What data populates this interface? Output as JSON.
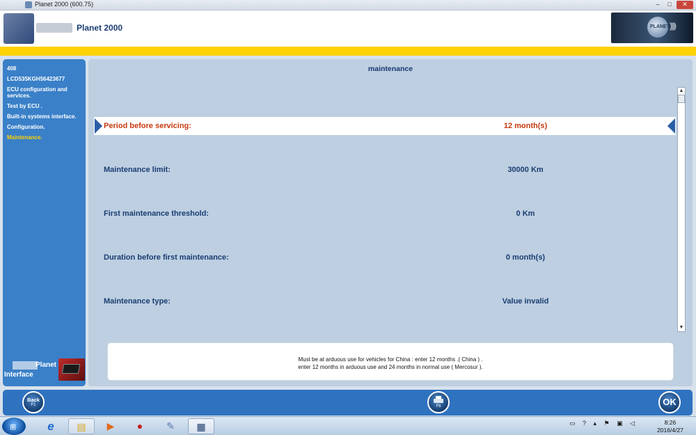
{
  "window": {
    "title": "Planet 2000 (600.75)",
    "min_label": "–",
    "max_label": "□",
    "close_label": "✕"
  },
  "header": {
    "app_title": "Planet 2000",
    "brand_text": "PLANET",
    "brand_waves": "))))"
  },
  "sidebar": {
    "items": [
      {
        "label": "408",
        "active": false
      },
      {
        "label": "LCD535KGH56423677",
        "active": false
      },
      {
        "label": "ECU configuration and services.",
        "active": false
      },
      {
        "label": "Test by ECU .",
        "active": false
      },
      {
        "label": "Built-in systems interface.",
        "active": false
      },
      {
        "label": "Configuration.",
        "active": false
      },
      {
        "label": "Maintenance.",
        "active": true
      }
    ],
    "logo_planet": "Planet",
    "logo_interface": "Interface"
  },
  "main": {
    "title": "maintenance",
    "rows": [
      {
        "label": "Period before servicing:",
        "value": "12 month(s)",
        "selected": true
      },
      {
        "label": "Maintenance limit:",
        "value": "30000 Km",
        "selected": false
      },
      {
        "label": "First maintenance threshold:",
        "value": "0 Km",
        "selected": false
      },
      {
        "label": "Duration before first maintenance:",
        "value": "0 month(s)",
        "selected": false
      },
      {
        "label": "Maintenance type:",
        "value": "Value invalid",
        "selected": false
      }
    ],
    "scroll_up": "▲",
    "scroll_down": "▼",
    "info_lines": [
      "Must be at arduous use for vehicles for China : enter 12 months .( China ) .",
      "enter 12 months in arduous use and 24 months in normal use ( Mercosur )."
    ]
  },
  "actions": {
    "back_label": "Back",
    "back_key": "F1",
    "print_key": "F6",
    "ok_label": "OK"
  },
  "taskbar": {
    "start_glyph": "⊞",
    "ie_glyph": "e",
    "folder_glyph": "▤",
    "media_glyph": "▶",
    "app1_glyph": "●",
    "app2_glyph": "✎",
    "app3_glyph": "▦",
    "tray_glyphs": "▭ ? ▴ ⚑ ▣ ◁",
    "time": "8:26",
    "date": "2016/4/27"
  }
}
